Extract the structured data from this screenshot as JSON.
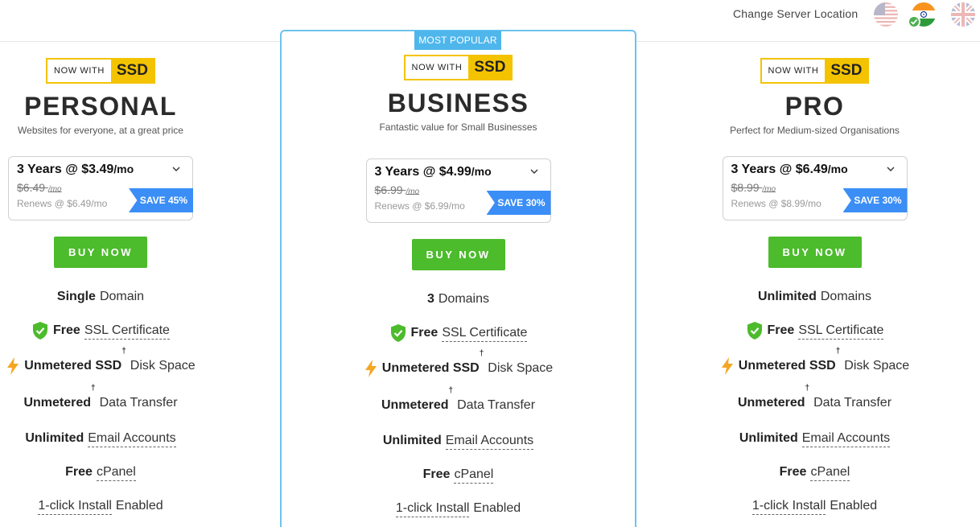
{
  "header": {
    "server_label": "Change Server Location",
    "flags": [
      {
        "icon": "us-flag-icon",
        "active": false
      },
      {
        "icon": "india-flag-icon",
        "active": true
      },
      {
        "icon": "uk-flag-icon",
        "active": false
      }
    ]
  },
  "colors": {
    "ssd_yellow": "#f4c300",
    "buy_green": "#4cbb2c",
    "save_blue": "#3a8ef6",
    "popular_blue": "#4fb6ec",
    "shield_green": "#4cbb2c",
    "bolt_orange": "#f5a623"
  },
  "plans": [
    {
      "id": "personal",
      "badge_now": "NOW WITH",
      "badge_ssd": "SSD",
      "name": "PERSONAL",
      "desc": "Websites for everyone, at a great price",
      "price": {
        "term": "3 Years @ $3.49",
        "unit": "/mo",
        "old": "$6.49",
        "old_unit": "/mo",
        "renews": "Renews @ $6.49/mo",
        "save": "SAVE 45%"
      },
      "buy": "BUY NOW",
      "features": {
        "domain_b": "Single",
        "domain_t": "Domain",
        "ssl_b": "Free",
        "ssl_t": "SSL Certificate",
        "disk_b": "Unmetered SSD",
        "disk_sup": "†",
        "disk_t": "Disk Space",
        "transfer_b": "Unmetered",
        "transfer_sup": "†",
        "transfer_t": "Data Transfer",
        "email_b": "Unlimited",
        "email_t": "Email Accounts",
        "cpanel_b": "Free",
        "cpanel_t": "cPanel",
        "install_u": "1-click Install",
        "install_t": "Enabled"
      }
    },
    {
      "id": "business",
      "popular": "MOST POPULAR",
      "badge_now": "NOW WITH",
      "badge_ssd": "SSD",
      "name": "BUSINESS",
      "desc": "Fantastic value for Small Businesses",
      "price": {
        "term": "3 Years @ $4.99",
        "unit": "/mo",
        "old": "$6.99",
        "old_unit": "/mo",
        "renews": "Renews @ $6.99/mo",
        "save": "SAVE 30%"
      },
      "buy": "BUY NOW",
      "features": {
        "domain_b": "3",
        "domain_t": "Domains",
        "ssl_b": "Free",
        "ssl_t": "SSL Certificate",
        "disk_b": "Unmetered SSD",
        "disk_sup": "†",
        "disk_t": "Disk Space",
        "transfer_b": "Unmetered",
        "transfer_sup": "†",
        "transfer_t": "Data Transfer",
        "email_b": "Unlimited",
        "email_t": "Email Accounts",
        "cpanel_b": "Free",
        "cpanel_t": "cPanel",
        "install_u": "1-click Install",
        "install_t": "Enabled"
      }
    },
    {
      "id": "pro",
      "badge_now": "NOW WITH",
      "badge_ssd": "SSD",
      "name": "PRO",
      "desc": "Perfect for Medium-sized Organisations",
      "price": {
        "term": "3 Years @ $6.49",
        "unit": "/mo",
        "old": "$8.99",
        "old_unit": "/mo",
        "renews": "Renews @ $8.99/mo",
        "save": "SAVE 30%"
      },
      "buy": "BUY NOW",
      "features": {
        "domain_b": "Unlimited",
        "domain_t": "Domains",
        "ssl_b": "Free",
        "ssl_t": "SSL Certificate",
        "disk_b": "Unmetered SSD",
        "disk_sup": "†",
        "disk_t": "Disk Space",
        "transfer_b": "Unmetered",
        "transfer_sup": "†",
        "transfer_t": "Data Transfer",
        "email_b": "Unlimited",
        "email_t": "Email Accounts",
        "cpanel_b": "Free",
        "cpanel_t": "cPanel",
        "install_u": "1-click Install",
        "install_t": "Enabled"
      }
    }
  ]
}
